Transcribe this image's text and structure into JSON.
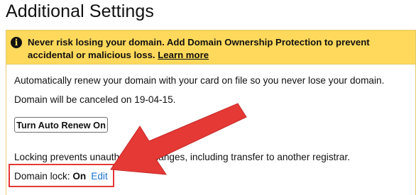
{
  "page": {
    "title": "Additional Settings"
  },
  "alert": {
    "icon": "info-icon",
    "message": "Never risk losing your domain. Add Domain Ownership Protection to prevent accidental or malicious loss. ",
    "link_label": "Learn more"
  },
  "auto_renew": {
    "description": "Automatically renew your domain with your card on file so you never lose your domain.",
    "cancel_notice": "Domain will be canceled on 19-04-15.",
    "button_label": "Turn Auto Renew On"
  },
  "lock": {
    "description": "Locking prevents unauthorized changes, including transfer to another registrar.",
    "label": "Domain lock: ",
    "value": "On",
    "edit_label": "Edit"
  },
  "colors": {
    "alert_background": "#fed95b",
    "link_blue": "#1b73d3",
    "annotation_red": "#e53935"
  }
}
